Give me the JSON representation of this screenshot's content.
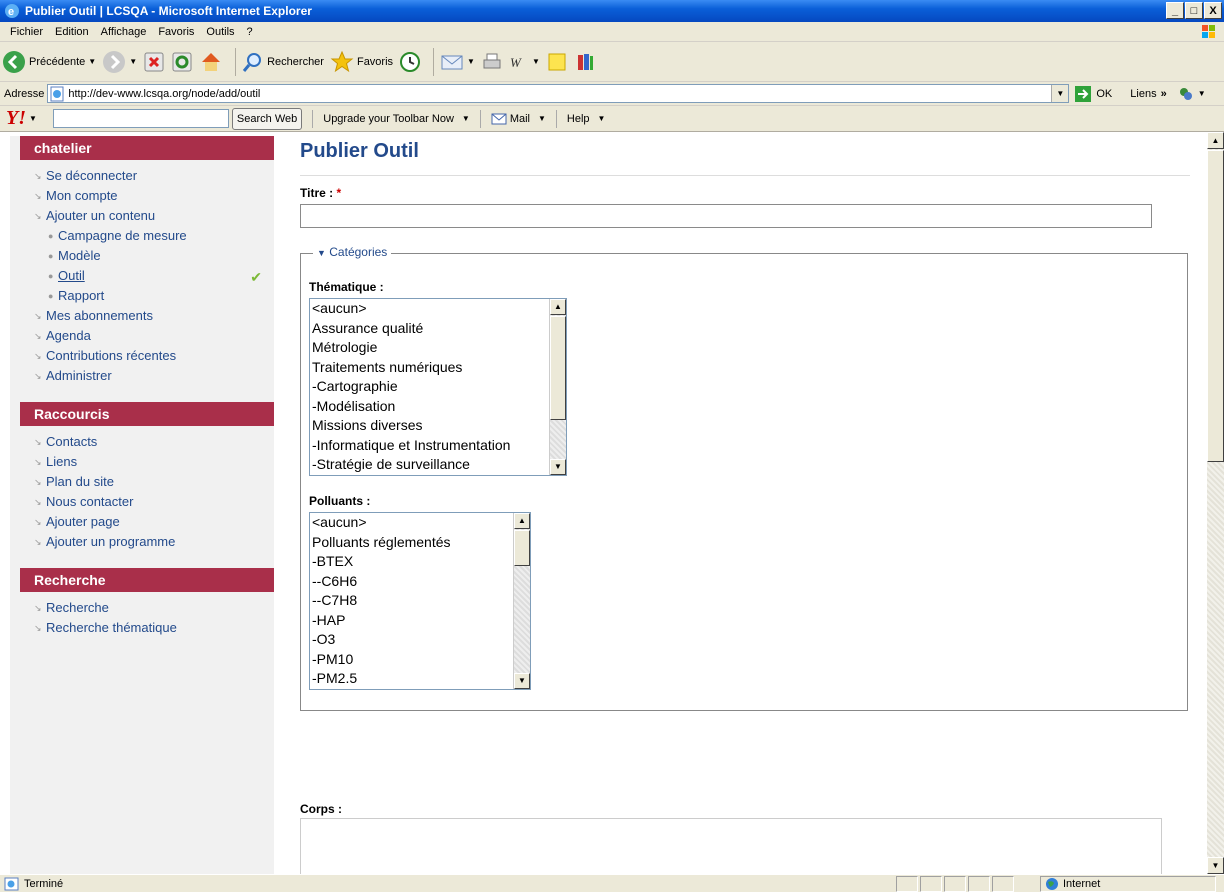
{
  "window": {
    "title": "Publier Outil | LCSQA - Microsoft Internet Explorer",
    "minimize": "_",
    "maximize": "□",
    "close": "X"
  },
  "menu": [
    "Fichier",
    "Edition",
    "Affichage",
    "Favoris",
    "Outils",
    "?"
  ],
  "toolbar": {
    "back_label": "Précédente",
    "search_label": "Rechercher",
    "favorites_label": "Favoris"
  },
  "address": {
    "label": "Adresse",
    "url": "http://dev-www.lcsqa.org/node/add/outil",
    "go_label": "OK",
    "links_label": "Liens"
  },
  "yahoo": {
    "logo": "Y!",
    "search_button": "Search Web",
    "upgrade": "Upgrade your Toolbar Now",
    "mail": "Mail",
    "help": "Help"
  },
  "sidebar": {
    "user_block": {
      "title": "chatelier",
      "items": [
        {
          "label": "Se déconnecter"
        },
        {
          "label": "Mon compte"
        },
        {
          "label": "Ajouter un contenu"
        },
        {
          "label": "Campagne de mesure"
        },
        {
          "label": "Modèle"
        },
        {
          "label": "Outil"
        },
        {
          "label": "Rapport"
        },
        {
          "label": "Mes abonnements"
        },
        {
          "label": "Agenda"
        },
        {
          "label": "Contributions récentes"
        },
        {
          "label": "Administrer"
        }
      ]
    },
    "shortcuts_block": {
      "title": "Raccourcis",
      "items": [
        {
          "label": "Contacts"
        },
        {
          "label": "Liens"
        },
        {
          "label": "Plan du site"
        },
        {
          "label": "Nous contacter"
        },
        {
          "label": "Ajouter page"
        },
        {
          "label": "Ajouter un programme"
        }
      ]
    },
    "search_block": {
      "title": "Recherche",
      "items": [
        {
          "label": "Recherche"
        },
        {
          "label": "Recherche thématique"
        }
      ]
    }
  },
  "form": {
    "page_title": "Publier Outil",
    "titre_label": "Titre :",
    "required_mark": "*",
    "categories_legend": "Catégories",
    "thematique_label": "Thématique :",
    "thematique_options": [
      "<aucun>",
      "Assurance qualité",
      "Métrologie",
      "Traitements numériques",
      "-Cartographie",
      "-Modélisation",
      "Missions diverses",
      "-Informatique et Instrumentation",
      "-Stratégie de surveillance"
    ],
    "polluants_label": "Polluants :",
    "polluants_options": [
      "<aucun>",
      "Polluants réglementés",
      "-BTEX",
      "--C6H6",
      "--C7H8",
      "-HAP",
      "-O3",
      "-PM10",
      "-PM2.5"
    ],
    "corps_label": "Corps :"
  },
  "status": {
    "text": "Terminé",
    "zone": "Internet"
  },
  "colors": {
    "block_header": "#a92f4a",
    "link": "#234a8b",
    "title_bar": "#0a5fd8"
  }
}
